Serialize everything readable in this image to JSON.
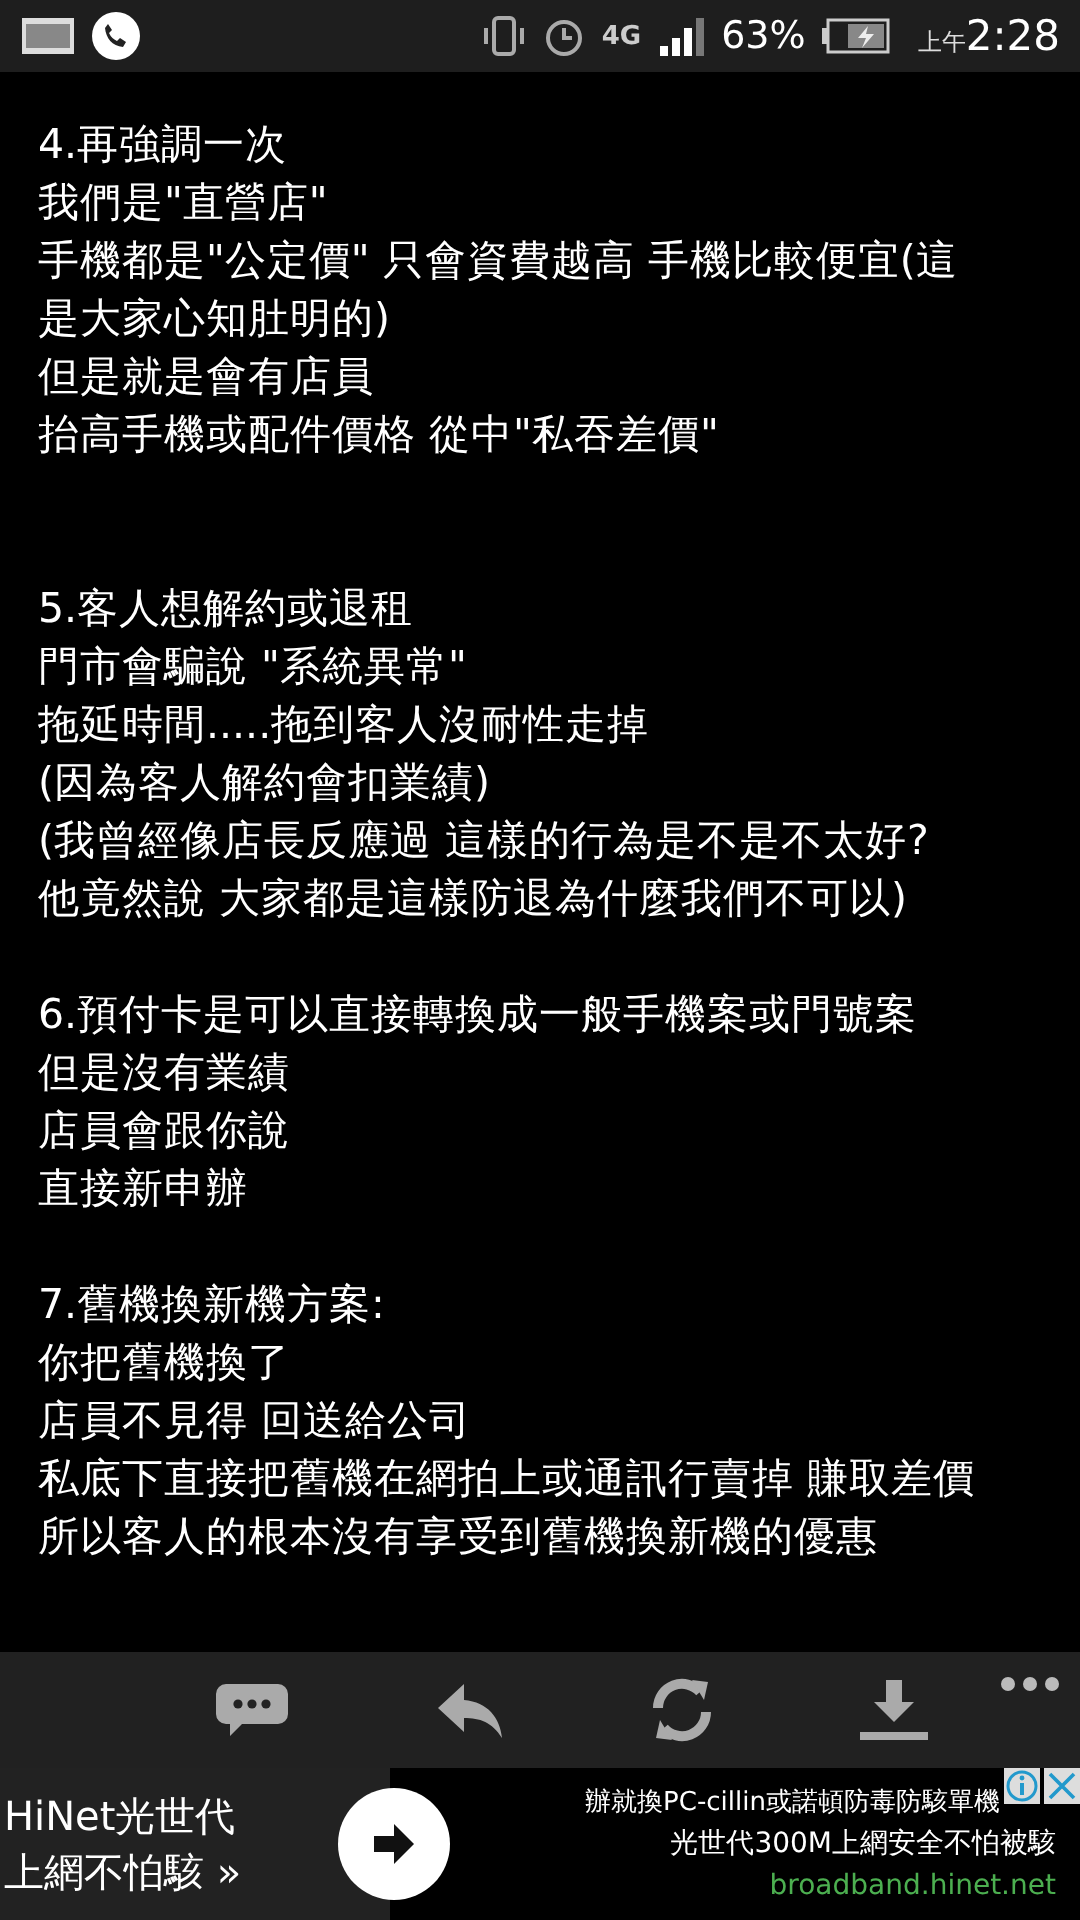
{
  "status_bar": {
    "network": "4G",
    "battery": "63%",
    "time_prefix": "上午",
    "time": "2:28"
  },
  "sections": [
    {
      "lines": [
        "4.再強調一次",
        "我們是\"直營店\"",
        "手機都是\"公定價\" 只會資費越高 手機比較便宜(這",
        "是大家心知肚明的)",
        "但是就是會有店員",
        "抬高手機或配件價格 從中\"私吞差價\""
      ]
    },
    {
      "lines": [
        "5.客人想解約或退租",
        "門市會騙說 \"系統異常\"",
        "拖延時間.....拖到客人沒耐性走掉",
        "(因為客人解約會扣業績)",
        "(我曾經像店長反應過 這樣的行為是不是不太好?",
        "他竟然說 大家都是這樣防退為什麼我們不可以)"
      ]
    },
    {
      "lines": [
        "6.預付卡是可以直接轉換成一般手機案或門號案",
        "但是沒有業績",
        "店員會跟你說",
        "直接新申辦"
      ]
    },
    {
      "lines": [
        "7.舊機換新機方案:",
        "你把舊機換了",
        "店員不見得 回送給公司",
        "私底下直接把舊機在網拍上或通訊行賣掉 賺取差價",
        "所以客人的根本沒有享受到舊機換新機的優惠"
      ]
    }
  ],
  "ad": {
    "headline_lines": [
      "HiNet光世代",
      "上網不怕駭 »"
    ],
    "body_lines": [
      "辦就換PC-cillin或諾頓防毒防駭單機",
      "光世代300M上網安全不怕被駭"
    ],
    "url": "broadband.hinet.net"
  }
}
